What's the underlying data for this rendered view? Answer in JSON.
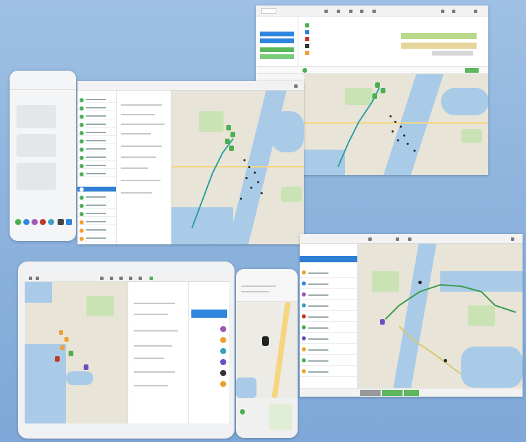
{
  "colors": {
    "background": "#8fb5de",
    "accent_green": "#5cb85c",
    "accent_blue": "#2e86de",
    "water": "#a9cbe8",
    "land": "#e8e4d8",
    "route_green": "#3a9a4a",
    "route_teal": "#2aa0a0"
  },
  "icons": [
    "toolbar-icon",
    "map-pin-icon",
    "avatar-icon",
    "app-icon"
  ]
}
